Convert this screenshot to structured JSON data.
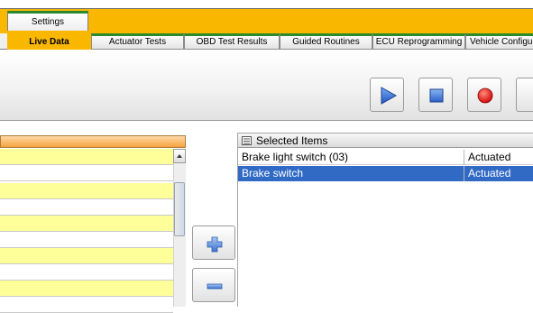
{
  "top_tabs": {
    "settings": "Settings"
  },
  "tabs": [
    {
      "label": "Live Data",
      "active": true
    },
    {
      "label": "Actuator Tests",
      "active": false
    },
    {
      "label": "OBD Test Results",
      "active": false
    },
    {
      "label": "Guided Routines",
      "active": false
    },
    {
      "label": "ECU Reprogramming",
      "active": false
    },
    {
      "label": "Vehicle Configuration",
      "active": false
    }
  ],
  "toolbar": {
    "buttons": [
      "play-icon",
      "stop-icon",
      "record-icon"
    ]
  },
  "selected_items": {
    "header": "Selected Items",
    "rows": [
      {
        "name": "Brake light switch (03)",
        "value": "Actuated",
        "selected": false
      },
      {
        "name": "Brake switch",
        "value": "Actuated",
        "selected": true
      }
    ]
  },
  "colors": {
    "accent_orange": "#f9b700",
    "tab_green": "#2c8a2c",
    "selection_blue": "#316ac5",
    "row_yellow": "#ffff99"
  }
}
